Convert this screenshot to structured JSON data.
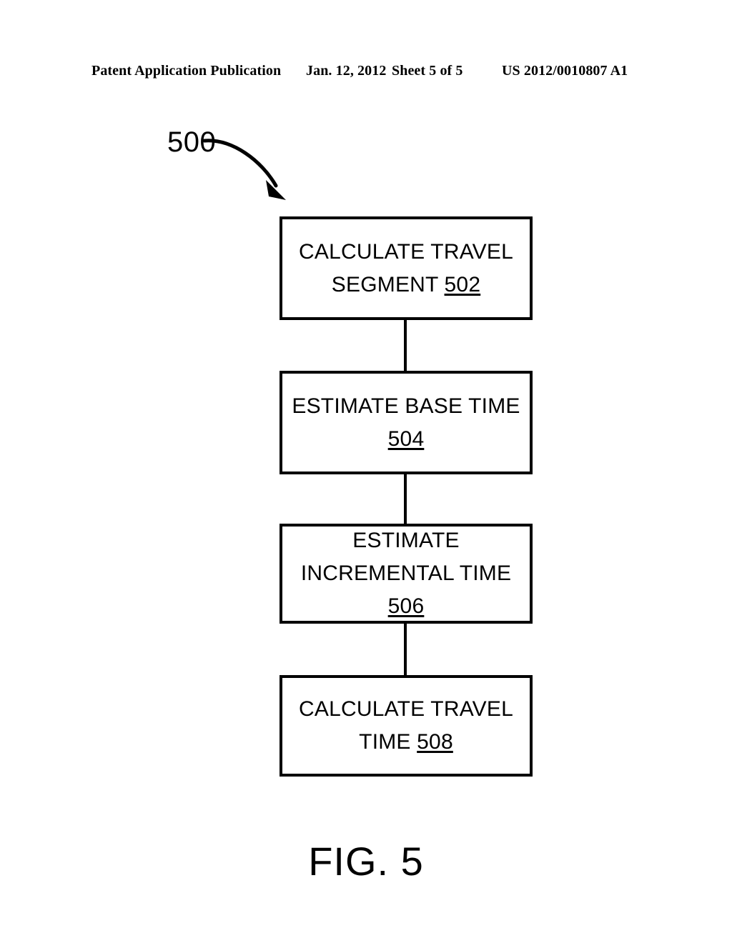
{
  "header": {
    "publication": "Patent Application Publication",
    "date": "Jan. 12, 2012",
    "sheet": "Sheet 5 of 5",
    "patent_number": "US 2012/0010807 A1"
  },
  "figure": {
    "caption": "FIG. 5",
    "reference_numeral": "500",
    "lead_arrow": "curved-arrow-pointing-down-right"
  },
  "flowchart": {
    "steps": [
      {
        "id": "502",
        "line1": "CALCULATE TRAVEL",
        "line2": "SEGMENT ",
        "ref": "502",
        "full_text": "CALCULATE TRAVEL SEGMENT 502"
      },
      {
        "id": "504",
        "line1": "ESTIMATE BASE TIME",
        "line2": "",
        "ref": "504",
        "full_text": "ESTIMATE BASE TIME 504"
      },
      {
        "id": "506",
        "line1": "ESTIMATE",
        "line2": "INCREMENTAL TIME",
        "ref": "506",
        "full_text": "ESTIMATE INCREMENTAL TIME 506"
      },
      {
        "id": "508",
        "line1": "CALCULATE TRAVEL",
        "line2": "TIME ",
        "ref": "508",
        "full_text": "CALCULATE TRAVEL TIME 508"
      }
    ],
    "connectors": [
      {
        "from": "502",
        "to": "504"
      },
      {
        "from": "504",
        "to": "506"
      },
      {
        "from": "506",
        "to": "508"
      }
    ]
  },
  "colors": {
    "ink": "#000000",
    "paper": "#ffffff"
  }
}
